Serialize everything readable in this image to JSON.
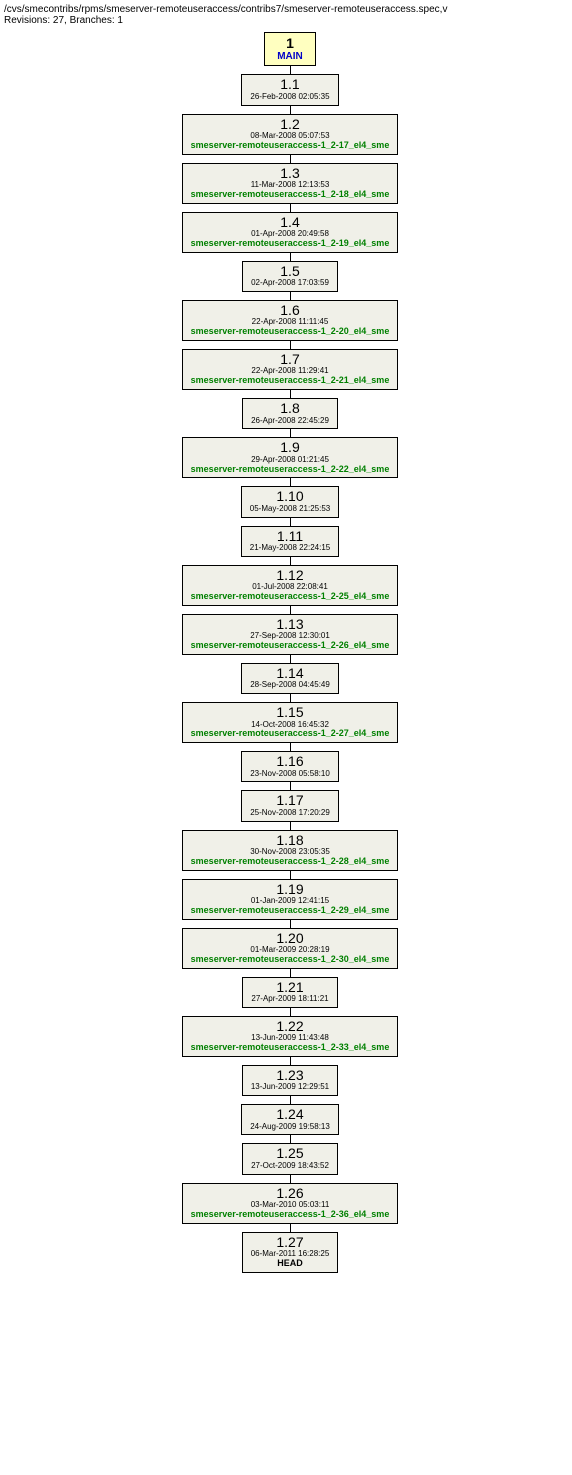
{
  "header": {
    "path": "/cvs/smecontribs/rpms/smeserver-remoteuseraccess/contribs7/smeserver-remoteuseraccess.spec,v",
    "meta": "Revisions: 27, Branches: 1"
  },
  "root": {
    "num": "1",
    "label": "MAIN"
  },
  "nodes": [
    {
      "rev": "1.1",
      "date": "26-Feb-2008 02:05:35",
      "tag": ""
    },
    {
      "rev": "1.2",
      "date": "08-Mar-2008 05:07:53",
      "tag": "smeserver-remoteuseraccess-1_2-17_el4_sme"
    },
    {
      "rev": "1.3",
      "date": "11-Mar-2008 12:13:53",
      "tag": "smeserver-remoteuseraccess-1_2-18_el4_sme"
    },
    {
      "rev": "1.4",
      "date": "01-Apr-2008 20:49:58",
      "tag": "smeserver-remoteuseraccess-1_2-19_el4_sme"
    },
    {
      "rev": "1.5",
      "date": "02-Apr-2008 17:03:59",
      "tag": ""
    },
    {
      "rev": "1.6",
      "date": "22-Apr-2008 11:11:45",
      "tag": "smeserver-remoteuseraccess-1_2-20_el4_sme"
    },
    {
      "rev": "1.7",
      "date": "22-Apr-2008 11:29:41",
      "tag": "smeserver-remoteuseraccess-1_2-21_el4_sme"
    },
    {
      "rev": "1.8",
      "date": "26-Apr-2008 22:45:29",
      "tag": ""
    },
    {
      "rev": "1.9",
      "date": "29-Apr-2008 01:21:45",
      "tag": "smeserver-remoteuseraccess-1_2-22_el4_sme"
    },
    {
      "rev": "1.10",
      "date": "05-May-2008 21:25:53",
      "tag": ""
    },
    {
      "rev": "1.11",
      "date": "21-May-2008 22:24:15",
      "tag": ""
    },
    {
      "rev": "1.12",
      "date": "01-Jul-2008 22:08:41",
      "tag": "smeserver-remoteuseraccess-1_2-25_el4_sme"
    },
    {
      "rev": "1.13",
      "date": "27-Sep-2008 12:30:01",
      "tag": "smeserver-remoteuseraccess-1_2-26_el4_sme"
    },
    {
      "rev": "1.14",
      "date": "28-Sep-2008 04:45:49",
      "tag": ""
    },
    {
      "rev": "1.15",
      "date": "14-Oct-2008 16:45:32",
      "tag": "smeserver-remoteuseraccess-1_2-27_el4_sme"
    },
    {
      "rev": "1.16",
      "date": "23-Nov-2008 05:58:10",
      "tag": ""
    },
    {
      "rev": "1.17",
      "date": "25-Nov-2008 17:20:29",
      "tag": ""
    },
    {
      "rev": "1.18",
      "date": "30-Nov-2008 23:05:35",
      "tag": "smeserver-remoteuseraccess-1_2-28_el4_sme"
    },
    {
      "rev": "1.19",
      "date": "01-Jan-2009 12:41:15",
      "tag": "smeserver-remoteuseraccess-1_2-29_el4_sme"
    },
    {
      "rev": "1.20",
      "date": "01-Mar-2009 20:28:19",
      "tag": "smeserver-remoteuseraccess-1_2-30_el4_sme"
    },
    {
      "rev": "1.21",
      "date": "27-Apr-2009 18:11:21",
      "tag": ""
    },
    {
      "rev": "1.22",
      "date": "13-Jun-2009 11:43:48",
      "tag": "smeserver-remoteuseraccess-1_2-33_el4_sme"
    },
    {
      "rev": "1.23",
      "date": "13-Jun-2009 12:29:51",
      "tag": ""
    },
    {
      "rev": "1.24",
      "date": "24-Aug-2009 19:58:13",
      "tag": ""
    },
    {
      "rev": "1.25",
      "date": "27-Oct-2009 18:43:52",
      "tag": ""
    },
    {
      "rev": "1.26",
      "date": "03-Mar-2010 05:03:11",
      "tag": "smeserver-remoteuseraccess-1_2-36_el4_sme"
    },
    {
      "rev": "1.27",
      "date": "06-Mar-2011 16:28:25",
      "tag": "",
      "head": "HEAD"
    }
  ]
}
